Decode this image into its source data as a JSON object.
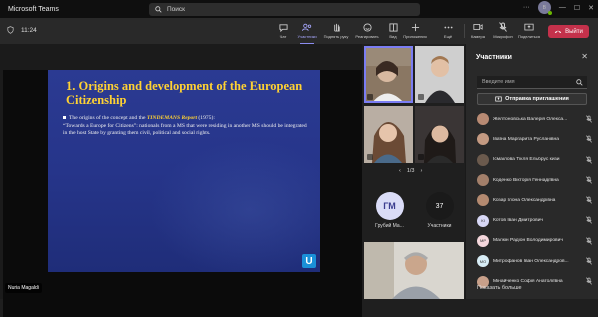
{
  "app": {
    "title": "Microsoft Teams"
  },
  "search": {
    "placeholder": "Поиск"
  },
  "window": {
    "more": "···",
    "minimize": "—",
    "maximize": "☐",
    "close": "✕",
    "avatar_initials": "В"
  },
  "meeting": {
    "timer": "11:24"
  },
  "toolbar": {
    "chat": "Чат",
    "participants": "Участники",
    "raise_hand": "Поднять руку",
    "reactions": "Реагировать",
    "view": "Вид",
    "apps": "Приложения",
    "more": "Ещё",
    "camera": "Камера",
    "mic": "Микрофон",
    "share": "Поделиться",
    "leave": "Выйти"
  },
  "slide": {
    "title": "1. Origins and development of the European Citizenship",
    "bullet_lead": "The origins of the concept and the ",
    "bullet_em": "TINDEMANS Report",
    "bullet_tail": " (1975):",
    "body": "“Towards a Europe for Citizens”: nationals from a MS that were residing in another MS should be integrated in the host State by granting them civil, political and social rights."
  },
  "presenter": {
    "name": "Nuria Magaldi"
  },
  "gallery": {
    "pager": "1/3",
    "pager_prev": "‹",
    "pager_next": "›",
    "user_initials": "ГМ",
    "user_name": "Грубий Ма...",
    "participants_count": "37",
    "participants_label": "Участники"
  },
  "panel": {
    "title": "Участники",
    "close": "✕",
    "search_placeholder": "Введите имя",
    "invite_label": "Отправка приглашения",
    "show_more": "Показать больше",
    "participants": [
      {
        "name": "Желтоновська Валерія Олекса...",
        "initials": "",
        "color": "#b88a73"
      },
      {
        "name": "Іваїна Маргарита Русланівна",
        "initials": "",
        "color": "#c49a82"
      },
      {
        "name": "Ісмаілова Тікля Ельбрус кизи",
        "initials": "",
        "color": "#6b5a4d"
      },
      {
        "name": "Коденко Вікторія Геннадіївна",
        "initials": "",
        "color": "#a37f6a"
      },
      {
        "name": "Козар Ілона Олександрівна",
        "initials": "",
        "color": "#b48a70"
      },
      {
        "name": "Котов Іван Дмитрович",
        "initials": "КІ",
        "color": "#d7d7f5"
      },
      {
        "name": "Малкін Радіон Володимирович",
        "initials": "МР",
        "color": "#f5d7dc"
      },
      {
        "name": "Митрофанов Іван Олександров...",
        "initials": "МО",
        "color": "#d7ecf5"
      },
      {
        "name": "Мінайченко Софія Анатоліївна",
        "initials": "",
        "color": "#c8a08a"
      }
    ]
  },
  "colors": {
    "accent": "#8b8cf0",
    "leave": "#c4314b",
    "slide_bg": "#2b3a92",
    "slide_title": "#ffd233"
  }
}
